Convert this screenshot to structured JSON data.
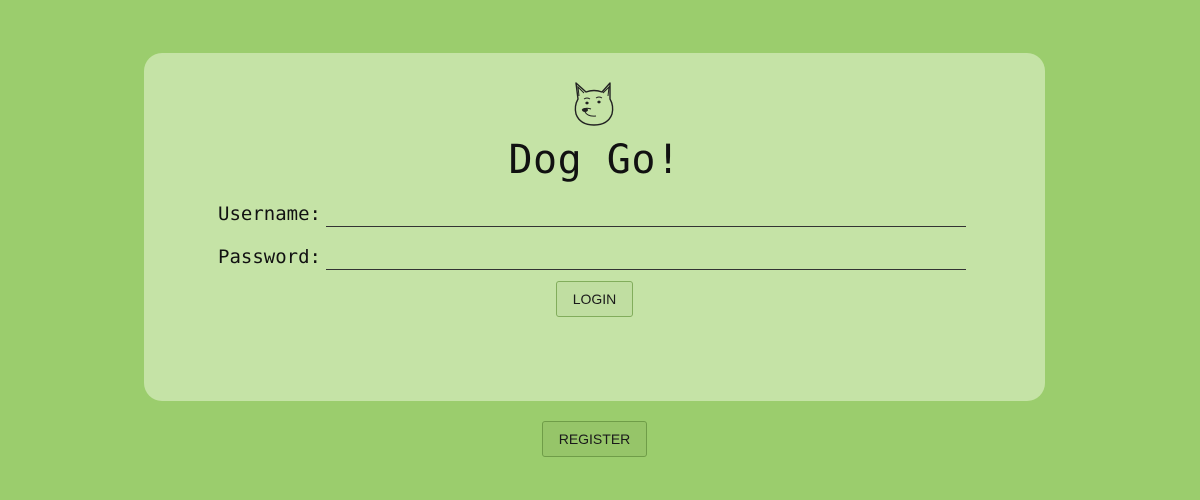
{
  "app": {
    "title": "Dog Go!",
    "logo_icon": "doge-dog-icon"
  },
  "login_form": {
    "username_label": "Username:",
    "username_value": "",
    "password_label": "Password:",
    "password_value": "",
    "login_label": "LOGIN"
  },
  "footer": {
    "register_label": "REGISTER"
  },
  "colors": {
    "page_background": "#9bcd6d",
    "card_background": "#c5e3a6",
    "text": "#111111"
  }
}
